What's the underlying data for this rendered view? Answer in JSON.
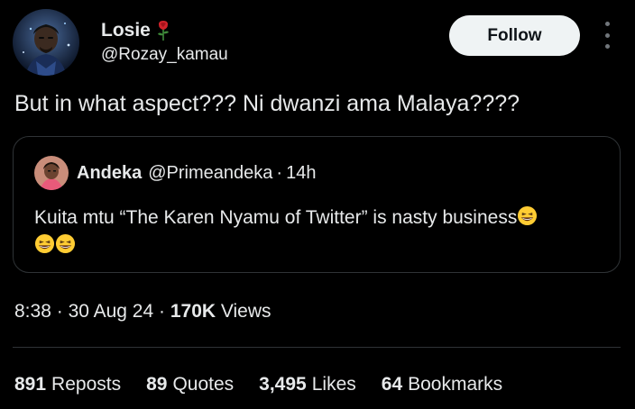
{
  "author": {
    "name": "Losie",
    "handle": "@Rozay_kamau",
    "badge_icon": "rose-icon",
    "avatar_icon": "avatar-portrait"
  },
  "follow_button": {
    "label": "Follow"
  },
  "more_icon": "more-vertical-icon",
  "tweet": {
    "text": "But in what aspect??? Ni dwanzi ama Malaya????"
  },
  "quote": {
    "name": "Andeka",
    "handle": "@Primeandeka",
    "separator": "·",
    "time": "14h",
    "text": "Kuita mtu “The Karen Nyamu of Twitter” is nasty business",
    "emoji_icon": "grinning-squinting-face-emoji",
    "emoji_count": 3
  },
  "meta": {
    "time": "8:38",
    "sep1": "·",
    "date": "30 Aug 24",
    "sep2": "·",
    "views_count": "170K",
    "views_label": "Views"
  },
  "stats": {
    "reposts_count": "891",
    "reposts_label": "Reposts",
    "quotes_count": "89",
    "quotes_label": "Quotes",
    "likes_count": "3,495",
    "likes_label": "Likes",
    "bookmarks_count": "64",
    "bookmarks_label": "Bookmarks"
  },
  "colors": {
    "background": "#000000",
    "text": "#e7e9ea",
    "border": "#2f3336",
    "follow_bg": "#eff3f4",
    "follow_text": "#0f1419"
  }
}
